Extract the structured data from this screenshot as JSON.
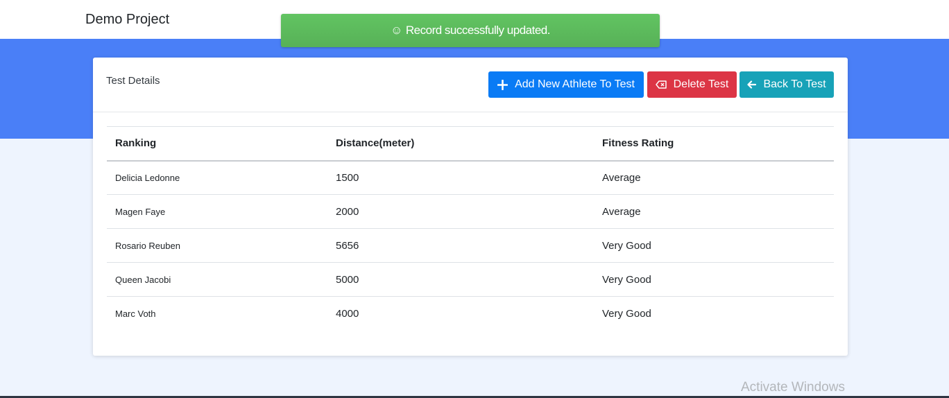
{
  "app": {
    "brand": "Demo Project"
  },
  "toast": {
    "icon": "smile-icon",
    "message": "Record successfully updated."
  },
  "card": {
    "title": "Test Details",
    "buttons": {
      "add": {
        "label": "Add New Athlete To Test",
        "icon": "plus-icon"
      },
      "delete": {
        "label": "Delete Test",
        "icon": "backspace-icon"
      },
      "back": {
        "label": "Back To Test",
        "icon": "arrow-left-icon"
      }
    }
  },
  "table": {
    "headers": [
      "Ranking",
      "Distance(meter)",
      "Fitness Rating"
    ],
    "rows": [
      [
        "Delicia Ledonne",
        "1500",
        "Average"
      ],
      [
        "Magen Faye",
        "2000",
        "Average"
      ],
      [
        "Rosario Reuben",
        "5656",
        "Very Good"
      ],
      [
        "Queen Jacobi",
        "5000",
        "Very Good"
      ],
      [
        "Marc Voth",
        "4000",
        "Very Good"
      ]
    ]
  },
  "watermark": "Activate Windows",
  "colors": {
    "primary": "#0a7bf5",
    "danger": "#dc3545",
    "info": "#17a2b8",
    "success": "#5cb85c",
    "band": "#4a7ff7"
  }
}
